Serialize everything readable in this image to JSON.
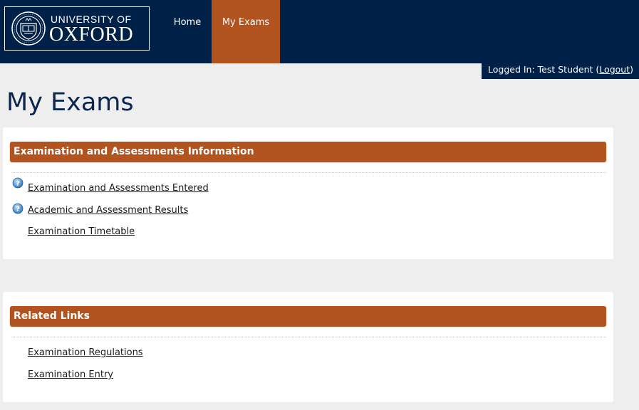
{
  "header": {
    "logo_line1": "UNIVERSITY OF",
    "logo_line2": "OXFORD",
    "nav": [
      {
        "label": "Home"
      },
      {
        "label": "My Exams"
      }
    ],
    "login_prefix": "Logged In: Test Student (",
    "logout_label": "Logout",
    "login_suffix": ")"
  },
  "page_title": "My Exams",
  "panels": [
    {
      "title": "Examination and Assessments Information",
      "links": [
        {
          "label": "Examination and Assessments Entered",
          "icon": "help-icon"
        },
        {
          "label": "Academic and Assessment Results",
          "icon": "help-icon"
        },
        {
          "label": "Examination Timetable"
        }
      ]
    },
    {
      "title": "Related Links",
      "links": [
        {
          "label": "Examination Regulations"
        },
        {
          "label": "Examination Entry"
        }
      ]
    }
  ],
  "colors": {
    "navy": "#002147",
    "accent": "#b1541f",
    "background": "#eeeeee"
  }
}
